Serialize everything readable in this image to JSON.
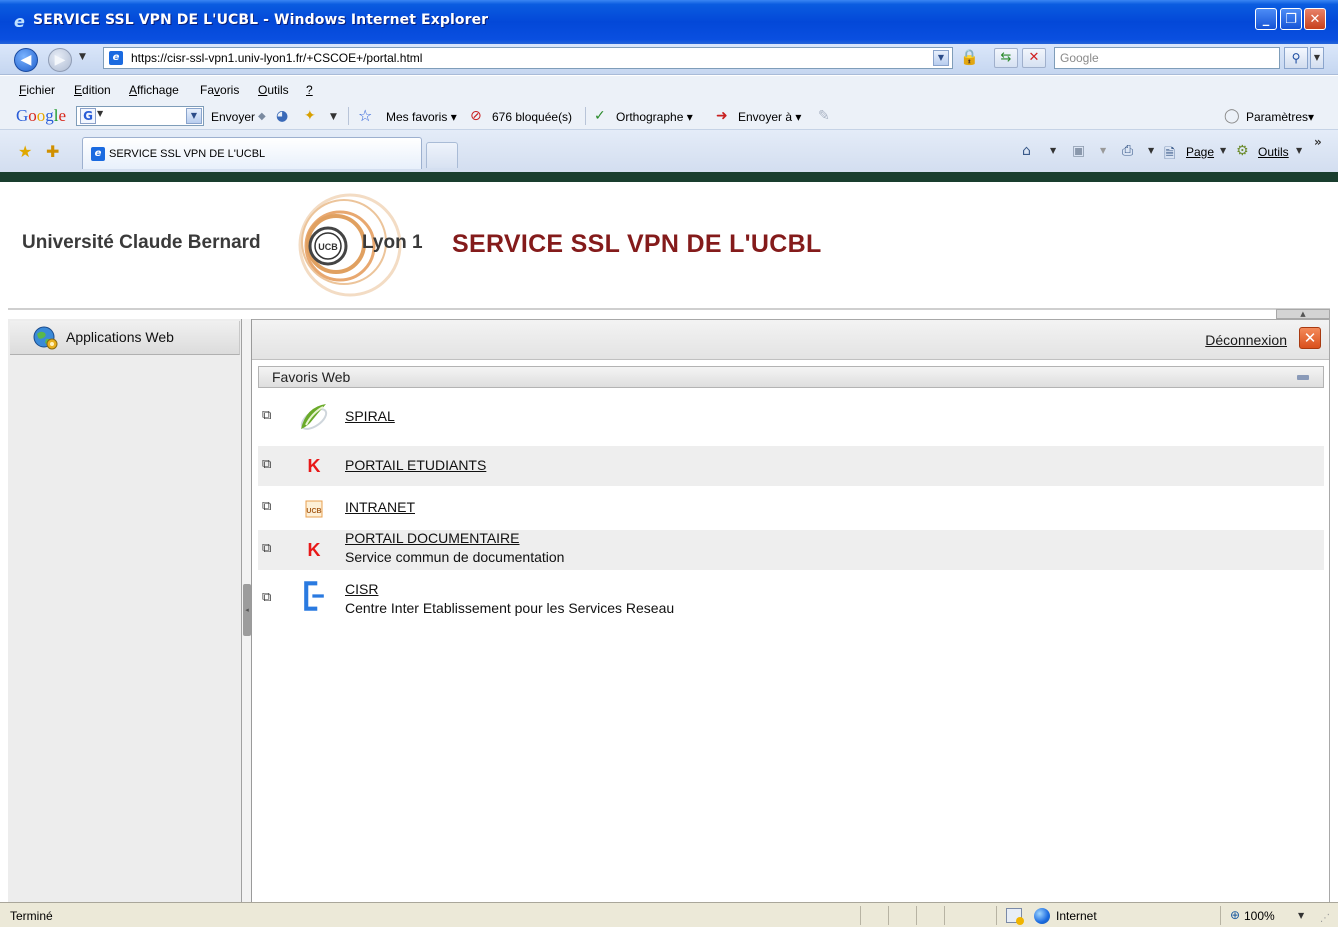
{
  "window": {
    "title": "SERVICE SSL VPN DE L'UCBL - Windows Internet Explorer",
    "buttons": {
      "minimize": "_",
      "maximize": "❐",
      "close": "✕"
    }
  },
  "address_bar": {
    "url": "https://cisr-ssl-vpn1.univ-lyon1.fr/+CSCOE+/portal.html",
    "search_placeholder": "Google"
  },
  "menu": [
    {
      "label": "Fichier",
      "accel": "F",
      "rest": "ichier"
    },
    {
      "label": "Edition",
      "accel": "E",
      "rest": "dition"
    },
    {
      "label": "Affichage",
      "accel": "A",
      "rest": "ffichage"
    },
    {
      "label": "Favoris",
      "accel_pre": "Fa",
      "accel": "v",
      "rest": "oris"
    },
    {
      "label": "Outils",
      "accel": "O",
      "rest": "utils"
    },
    {
      "label": "?",
      "accel": "?",
      "rest": ""
    }
  ],
  "google_toolbar": {
    "logo": [
      "G",
      "o",
      "o",
      "g",
      "l",
      "e"
    ],
    "send": "Envoyer",
    "bookmarks": "Mes favoris",
    "blocked": "676 bloquée(s)",
    "spellcheck": "Orthographe",
    "send_to": "Envoyer à",
    "settings": "Paramètres"
  },
  "tabs": {
    "active_title": "SERVICE SSL VPN DE L'UCBL"
  },
  "command_bar": {
    "page": "Page",
    "tools": "Outils"
  },
  "page": {
    "university_left": "Université Claude Bernard",
    "university_right": "Lyon 1",
    "logo_text": "UCB",
    "service_title": "SERVICE SSL VPN DE L'UCBL",
    "nav_label": "Applications Web",
    "logout": "Déconnexion",
    "section_title": "Favoris Web",
    "bookmarks": [
      {
        "name": "SPIRAL",
        "desc": "",
        "logo": "spiral-logo"
      },
      {
        "name": "PORTAIL ETUDIANTS",
        "desc": "",
        "logo": "k-logo"
      },
      {
        "name": "INTRANET",
        "desc": "",
        "logo": "ucb-logo"
      },
      {
        "name": "PORTAIL DOCUMENTAIRE",
        "desc": "Service commun de documentation",
        "logo": "k-logo"
      },
      {
        "name": "CISR",
        "desc": "Centre Inter Etablissement pour les Services Reseau",
        "logo": "cisr-logo"
      }
    ]
  },
  "status_bar": {
    "status": "Terminé",
    "zone": "Internet",
    "zoom": "100%"
  },
  "colors": {
    "title_accent": "#841b1b",
    "titlebar_blue": "#0348d8"
  }
}
